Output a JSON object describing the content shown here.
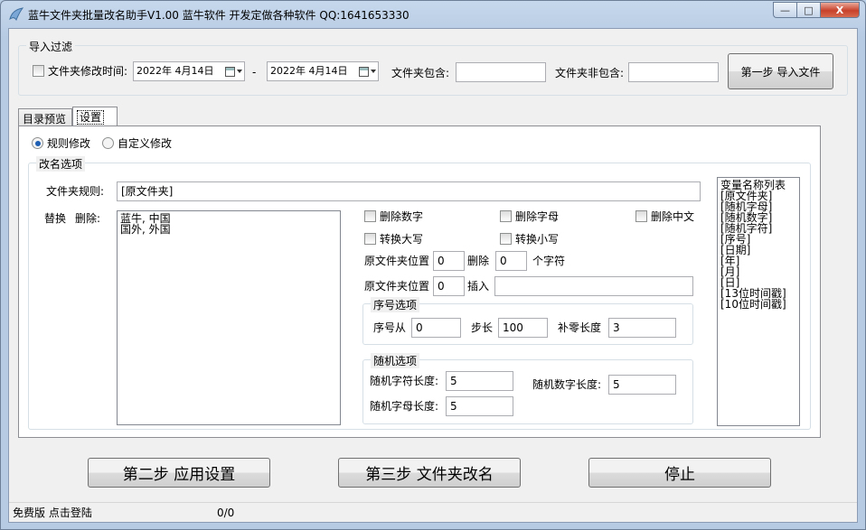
{
  "window": {
    "title": "蓝牛文件夹批量改名助手V1.00 蓝牛软件 开发定做各种软件   QQ:1641653330",
    "minimize": "—",
    "maximize": "□",
    "close": "X"
  },
  "import_filter": {
    "group_title": "导入过滤",
    "folder_time_label": "文件夹修改时间:",
    "date_from": "2022年 4月14日",
    "date_sep": "-",
    "date_to": "2022年 4月14日",
    "include_label": "文件夹包含:",
    "include_value": "",
    "exclude_label": "文件夹非包含:",
    "exclude_value": "",
    "import_button": "第一步  导入文件"
  },
  "tabs": [
    {
      "label": "目录预览"
    },
    {
      "label": "设置"
    }
  ],
  "mode": {
    "rule": "规则修改",
    "custom": "自定义修改"
  },
  "rename": {
    "group_title": "改名选项",
    "folder_rule_label": "文件夹规则:",
    "folder_rule_value": "[原文件夹]",
    "replace_label": "替换",
    "delete_label": "删除:",
    "replace_lines": [
      "蓝牛, 中国",
      "国外, 外国"
    ],
    "opt_delete_digits": "删除数字",
    "opt_delete_letters": "删除字母",
    "opt_delete_chinese": "删除中文",
    "opt_to_upper": "转换大写",
    "opt_to_lower": "转换小写",
    "pos_label_1": "原文件夹位置",
    "pos_value_1": "0",
    "delete_word": "删除",
    "delete_count": "0",
    "chars_label": "个字符",
    "pos_label_2": "原文件夹位置",
    "pos_value_2": "0",
    "insert_label": "插入",
    "insert_value": ""
  },
  "sequence": {
    "group_title": "序号选项",
    "from_label": "序号从",
    "from_value": "0",
    "step_label": "步长",
    "step_value": "100",
    "pad_label": "补零长度",
    "pad_value": "3"
  },
  "random": {
    "group_title": "随机选项",
    "char_len_label": "随机字符长度:",
    "char_len_value": "5",
    "digit_len_label": "随机数字长度:",
    "digit_len_value": "5",
    "letter_len_label": "随机字母长度:",
    "letter_len_value": "5"
  },
  "variables": {
    "title": "变量名称列表",
    "items": [
      "[原文件夹]",
      "[随机字母]",
      "[随机数字]",
      "[随机字符]",
      "[序号]",
      "[日期]",
      "[年]",
      "[月]",
      "[日]",
      "[13位时间戳]",
      "[10位时间戳]"
    ]
  },
  "actions": {
    "apply": "第二步  应用设置",
    "rename": "第三步  文件夹改名",
    "stop": "停止"
  },
  "status": {
    "login": "免费版 点击登陆",
    "progress": "0/0"
  }
}
